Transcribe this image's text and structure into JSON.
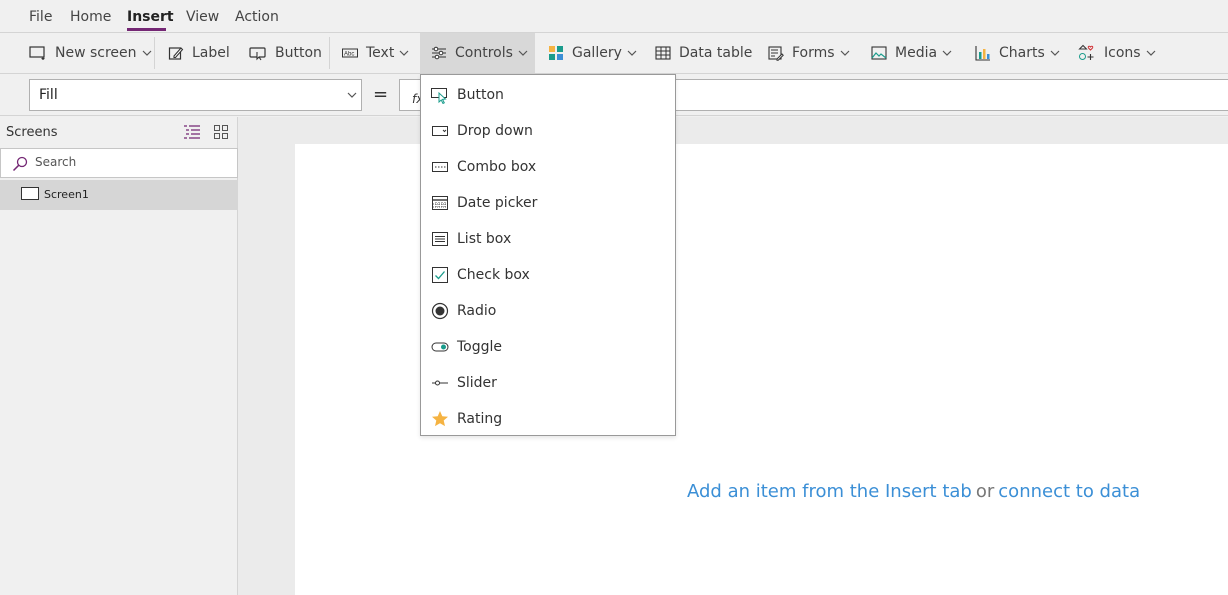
{
  "menubar": {
    "tabs": [
      {
        "label": "File"
      },
      {
        "label": "Home"
      },
      {
        "label": "Insert"
      },
      {
        "label": "View"
      },
      {
        "label": "Action"
      }
    ],
    "active_tab": "Insert"
  },
  "ribbon": {
    "new_screen": "New screen",
    "label": "Label",
    "button": "Button",
    "text": "Text",
    "controls": "Controls",
    "gallery": "Gallery",
    "data_table": "Data table",
    "forms": "Forms",
    "media": "Media",
    "charts": "Charts",
    "icons": "Icons",
    "text_icon_label": "Abc"
  },
  "formula_bar": {
    "property": "Fill",
    "equals": "=",
    "fx": "fx"
  },
  "left_panel": {
    "title": "Screens",
    "search_placeholder": "Search",
    "screens": [
      "Screen1"
    ]
  },
  "canvas": {
    "hint_link1": "Add an item from the Insert tab",
    "hint_or": "or",
    "hint_link2": "connect to data"
  },
  "controls_menu": {
    "items": [
      {
        "label": "Button",
        "icon": "button-icon"
      },
      {
        "label": "Drop down",
        "icon": "dropdown-icon"
      },
      {
        "label": "Combo box",
        "icon": "combobox-icon"
      },
      {
        "label": "Date picker",
        "icon": "calendar-icon"
      },
      {
        "label": "List box",
        "icon": "listbox-icon"
      },
      {
        "label": "Check box",
        "icon": "checkbox-icon"
      },
      {
        "label": "Radio",
        "icon": "radio-icon"
      },
      {
        "label": "Toggle",
        "icon": "toggle-icon"
      },
      {
        "label": "Slider",
        "icon": "slider-icon"
      },
      {
        "label": "Rating",
        "icon": "star-icon"
      }
    ]
  },
  "colors": {
    "accent": "#742774",
    "link": "#3b8fd6",
    "icon_teal": "#1a9c8c",
    "star": "#f5b342"
  }
}
